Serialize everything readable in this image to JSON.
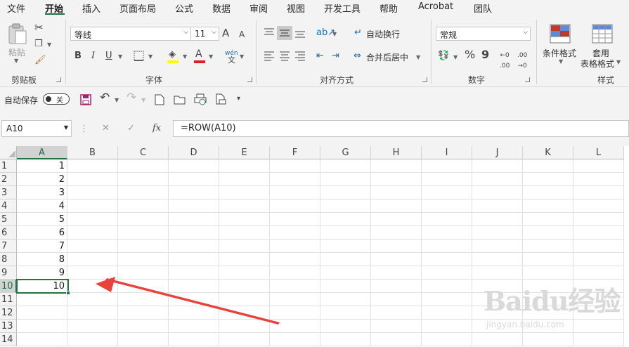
{
  "menu": [
    "文件",
    "开始",
    "插入",
    "页面布局",
    "公式",
    "数据",
    "审阅",
    "视图",
    "开发工具",
    "帮助",
    "Acrobat",
    "团队"
  ],
  "ribbon": {
    "clipboard": {
      "paste_label": "粘贴",
      "group_label": "剪贴板"
    },
    "font": {
      "name": "等线",
      "size": "11",
      "group_label": "字体",
      "bold": "B",
      "italic": "I",
      "underline": "U",
      "grow": "A",
      "shrink": "A",
      "phonetic": "wén"
    },
    "alignment": {
      "wrap_label": "自动换行",
      "merge_label": "合并后居中",
      "group_label": "对齐方式"
    },
    "number": {
      "format": "常规",
      "group_label": "数字",
      "percent": "%",
      "comma": "9"
    },
    "styles": {
      "conditional_label": "条件格式",
      "table_label_1": "套用",
      "table_label_2": "表格格式",
      "group_label": "样式"
    }
  },
  "qat": {
    "autosave_label": "自动保存",
    "toggle_label": "关"
  },
  "formula_bar": {
    "name_box": "A10",
    "formula": "=ROW(A10)",
    "fx": "fx"
  },
  "columns": [
    "A",
    "B",
    "C",
    "D",
    "E",
    "F",
    "G",
    "H",
    "I",
    "J",
    "K",
    "L"
  ],
  "rows": [
    "1",
    "2",
    "3",
    "4",
    "5",
    "6",
    "7",
    "8",
    "9",
    "10",
    "11",
    "12",
    "13",
    "14"
  ],
  "cells_a": [
    "1",
    "2",
    "3",
    "4",
    "5",
    "6",
    "7",
    "8",
    "9",
    "10",
    "",
    "",
    "",
    ""
  ],
  "watermark": {
    "brand": "Baidu经验",
    "url": "jingyan.baidu.com"
  },
  "colors": {
    "accent": "#217346",
    "arrow": "#e8423a"
  }
}
